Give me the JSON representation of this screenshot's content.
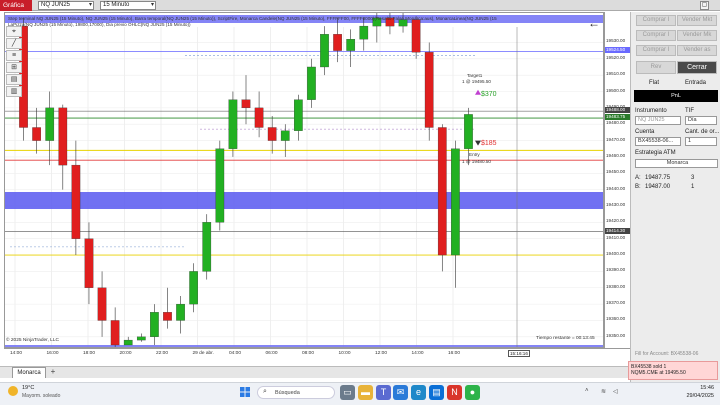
{
  "app": {
    "tab_label": "Gráfica",
    "instrument": "NQ JUN25",
    "interval": "15 Minuto"
  },
  "chart": {
    "indicator_line_1": "Step terminal NQ JUN25 (15 Minuto), NQ JUN25 (15 Minuto), Barra temporal(NQ JUN25 (15 Minuto)), ScriptFire, Monarca Candele(NQ JUN25 (15 Minuto), FFFFFF00, FFFF0000)(Resalto:False,Monarca:aus), MonarcaLinea(NQ JUN25 (15",
    "indicator_line_2": "LaPizza(NQ JUN25 (15 Minuto), 19800,17000), Dia previo OHLC(NQ JUN25 (15 Minuto))",
    "copyright": "© 2025 NinjaTrader, LLC",
    "time_remaining": "Tiempo restante = 00:13:45",
    "target_label": "Target1",
    "target_order": "1 @ 19495.50",
    "target_pnl": "$370",
    "entry_label": "Entry",
    "entry_order": "1 @ 19480.50",
    "stop_pnl": "$185",
    "price_ticks": [
      "19530.00",
      "19520.00",
      "19510.00",
      "19500.00",
      "19490.00",
      "19480.00",
      "19470.00",
      "19460.00",
      "19450.00",
      "19440.00",
      "19430.00",
      "19420.00",
      "19410.00",
      "19400.00",
      "19390.00",
      "19380.00",
      "19370.00",
      "19360.00",
      "19350.00"
    ],
    "price_markers": [
      {
        "label": "19524.50",
        "color": "#6a6aff",
        "price": 19524.5
      },
      {
        "label": "19488.00",
        "color": "#444444",
        "price": 19488.0
      },
      {
        "label": "19483.75",
        "color": "#2a7a2a",
        "price": 19483.75
      },
      {
        "label": "19414.30",
        "color": "#444444",
        "price": 19414.3
      }
    ],
    "time_ticks": [
      "14:00",
      "16:00",
      "18:00",
      "20:00",
      "22:00",
      "29 de abr.",
      "04:00",
      "06:00",
      "08:00",
      "10:00",
      "12:00",
      "14:00",
      "16:00"
    ],
    "cursor_time": "15:16:16"
  },
  "chart_data": {
    "type": "candlestick",
    "ylim": [
      19345,
      19537
    ],
    "candles": [
      [
        19540,
        19545,
        19470,
        19478
      ],
      [
        19478,
        19490,
        19462,
        19470
      ],
      [
        19470,
        19500,
        19455,
        19490
      ],
      [
        19490,
        19492,
        19440,
        19455
      ],
      [
        19455,
        19470,
        19400,
        19410
      ],
      [
        19410,
        19420,
        19370,
        19380
      ],
      [
        19380,
        19390,
        19350,
        19360
      ],
      [
        19360,
        19368,
        19340,
        19345
      ],
      [
        19345,
        19350,
        19348,
        19348
      ],
      [
        19348,
        19352,
        19347,
        19350
      ],
      [
        19350,
        19370,
        19345,
        19365
      ],
      [
        19365,
        19380,
        19355,
        19360
      ],
      [
        19360,
        19375,
        19352,
        19370
      ],
      [
        19370,
        19395,
        19365,
        19390
      ],
      [
        19390,
        19425,
        19385,
        19420
      ],
      [
        19420,
        19470,
        19415,
        19465
      ],
      [
        19465,
        19500,
        19460,
        19495
      ],
      [
        19495,
        19510,
        19480,
        19490
      ],
      [
        19490,
        19500,
        19472,
        19478
      ],
      [
        19478,
        19485,
        19462,
        19470
      ],
      [
        19470,
        19480,
        19460,
        19476
      ],
      [
        19476,
        19498,
        19470,
        19495
      ],
      [
        19495,
        19520,
        19490,
        19515
      ],
      [
        19515,
        19540,
        19510,
        19535
      ],
      [
        19535,
        19545,
        19518,
        19525
      ],
      [
        19525,
        19538,
        19515,
        19532
      ],
      [
        19532,
        19545,
        19525,
        19540
      ],
      [
        19540,
        19548,
        19530,
        19545
      ],
      [
        19545,
        19550,
        19535,
        19540
      ],
      [
        19540,
        19548,
        19536,
        19544
      ],
      [
        19544,
        19546,
        19520,
        19524
      ],
      [
        19524,
        19530,
        19470,
        19478
      ],
      [
        19478,
        19480,
        19390,
        19400
      ],
      [
        19400,
        19470,
        19380,
        19465
      ],
      [
        19465,
        19490,
        19455,
        19486
      ]
    ]
  },
  "right_panel": {
    "buttons_row1": [
      "Comprar I",
      "Vender Mkt"
    ],
    "buttons_row2": [
      "Comprar I",
      "Vender Mk"
    ],
    "buttons_row3": [
      "Comprar I",
      "Vender as"
    ],
    "rev": "Rev",
    "cerrar": "Cerrar",
    "flat": "Flat",
    "entrada": "Entrada",
    "pnl": "PnL",
    "instrumento_label": "Instrumento",
    "instrumento_value": "NQ JUN25",
    "tif_label": "TIF",
    "tif_value": "Día",
    "cuenta_label": "Cuenta",
    "cuenta_value": "BX45538-06...",
    "cant_label": "Cant. de or...",
    "cant_value": "1",
    "estrategia_label": "Estrategia ATM",
    "estrategia_value": "Monarca",
    "ask_label": "A:",
    "ask_value": "19487.75",
    "ask_size": "3",
    "bid_label": "B:",
    "bid_value": "19487.00",
    "bid_size": "1",
    "fill_text": "Fill for Account: BX45538-06",
    "alert_line1": "BX45538 sold 1",
    "alert_line2": "NQM5.CME at 19495.50"
  },
  "bottom_tabs": {
    "tab1": "Monarca",
    "add": "+"
  },
  "taskbar": {
    "weather_temp": "19°C",
    "weather_desc": "Mayorm. soleado",
    "search": "Búsqueda",
    "time": "15:46",
    "date": "29/04/2025"
  }
}
